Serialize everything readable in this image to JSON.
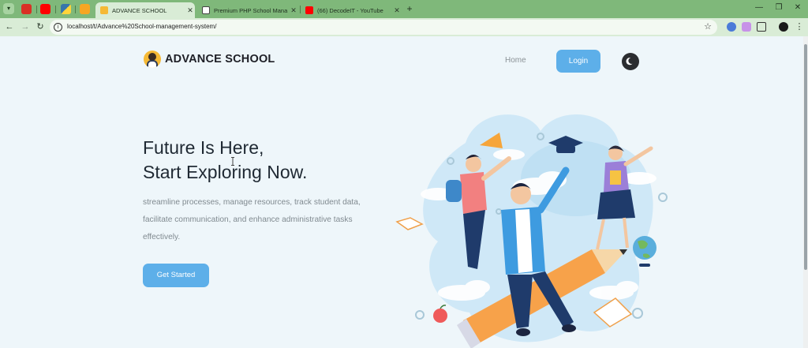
{
  "browser": {
    "tabs": [
      {
        "title": "ADVANCE SCHOOL",
        "active": true,
        "favicon_color": "#f5b935"
      },
      {
        "title": "Premium PHP School Mana",
        "active": false,
        "favicon_color": "#ffffff"
      },
      {
        "title": "(66) DecodeIT - YouTube",
        "active": false,
        "favicon_color": "#ff0000"
      }
    ],
    "pinned_icons": [
      "gmail-icon",
      "youtube-icon",
      "python-icon",
      "play-icon"
    ],
    "new_tab_label": "+",
    "window_controls": [
      "—",
      "❐",
      "✕"
    ],
    "address": "localhost/t/Advance%20School-management-system/",
    "accent": "#7fb87a"
  },
  "site": {
    "brand": "ADVANCE SCHOOL",
    "nav": {
      "home": "Home",
      "login": "Login"
    },
    "hero": {
      "title_line1": "Future Is Here,",
      "title_line2": "Start Exploring Now.",
      "description": "streamline processes, manage resources, track student data, facilitate communication, and enhance administrative tasks effectively.",
      "cta": "Get Started"
    },
    "colors": {
      "primary": "#5dafe9",
      "heading": "#1f2933",
      "muted": "#808a90",
      "background": "#eef6fa"
    }
  }
}
